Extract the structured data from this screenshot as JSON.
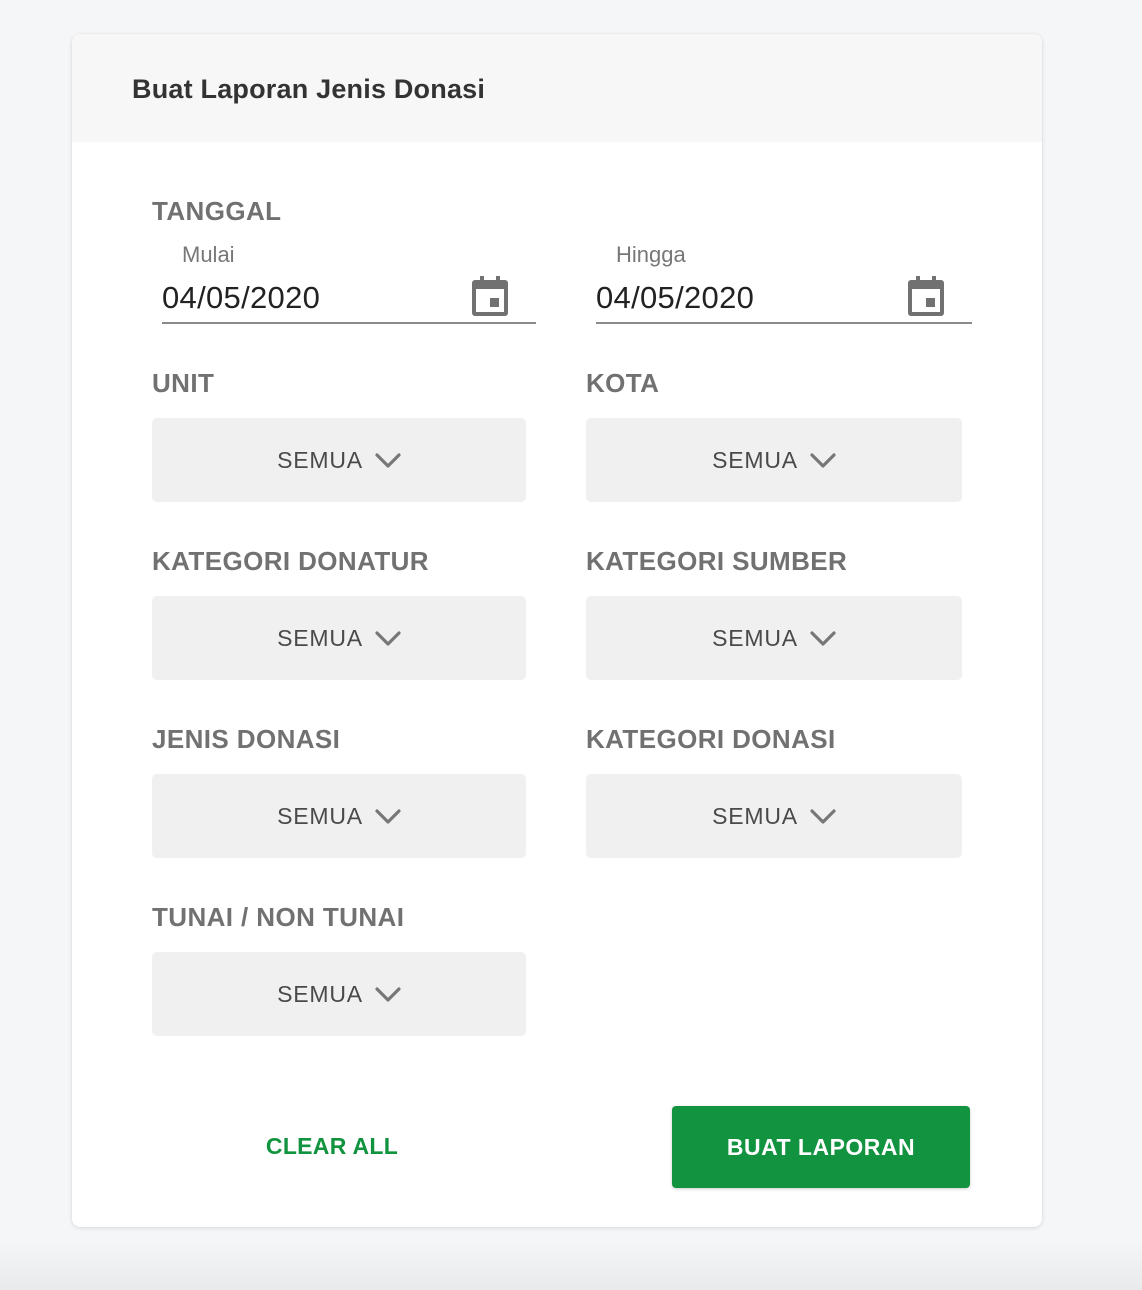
{
  "form": {
    "title": "Buat Laporan Jenis Donasi",
    "date_section_label": "TANGGAL",
    "start_date": {
      "label": "Mulai",
      "value": "04/05/2020"
    },
    "end_date": {
      "label": "Hingga",
      "value": "04/05/2020"
    },
    "filters": [
      {
        "label": "UNIT",
        "value": "SEMUA"
      },
      {
        "label": "KOTA",
        "value": "SEMUA"
      },
      {
        "label": "KATEGORI DONATUR",
        "value": "SEMUA"
      },
      {
        "label": "KATEGORI SUMBER",
        "value": "SEMUA"
      },
      {
        "label": "JENIS DONASI",
        "value": "SEMUA"
      },
      {
        "label": "KATEGORI DONASI",
        "value": "SEMUA"
      },
      {
        "label": "TUNAI / NON TUNAI",
        "value": "SEMUA"
      }
    ],
    "clear_label": "CLEAR ALL",
    "submit_label": "BUAT LAPORAN"
  },
  "icons": {
    "date_picker": "calendar-icon",
    "dropdown": "chevron-down-icon"
  },
  "colors": {
    "primary": "#12933f",
    "label": "#717171",
    "select_bg": "#f0f0f0",
    "header_bg": "#f7f7f7"
  }
}
